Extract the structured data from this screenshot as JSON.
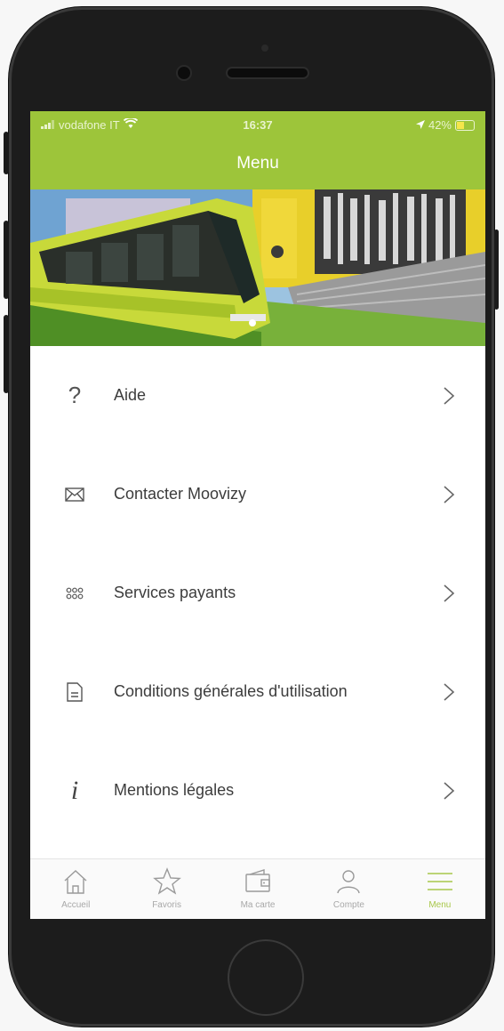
{
  "status_bar": {
    "carrier": "vodafone IT",
    "time": "16:37",
    "battery": "42%"
  },
  "header": {
    "title": "Menu"
  },
  "menu": {
    "items": [
      {
        "label": "Aide",
        "icon": "help-icon"
      },
      {
        "label": "Contacter Moovizy",
        "icon": "envelope-icon"
      },
      {
        "label": "Services payants",
        "icon": "grid-dots-icon"
      },
      {
        "label": "Conditions générales d'utilisation",
        "icon": "document-icon"
      },
      {
        "label": "Mentions légales",
        "icon": "info-icon"
      }
    ]
  },
  "tab_bar": {
    "tabs": [
      {
        "label": "Accueil",
        "icon": "home-icon"
      },
      {
        "label": "Favoris",
        "icon": "star-icon"
      },
      {
        "label": "Ma carte",
        "icon": "wallet-icon"
      },
      {
        "label": "Compte",
        "icon": "user-icon"
      },
      {
        "label": "Menu",
        "icon": "hamburger-icon",
        "active": true
      }
    ]
  },
  "colors": {
    "brand_green": "#9dc53a",
    "active_tab": "#a8c74a",
    "text": "#3c3c3c"
  }
}
